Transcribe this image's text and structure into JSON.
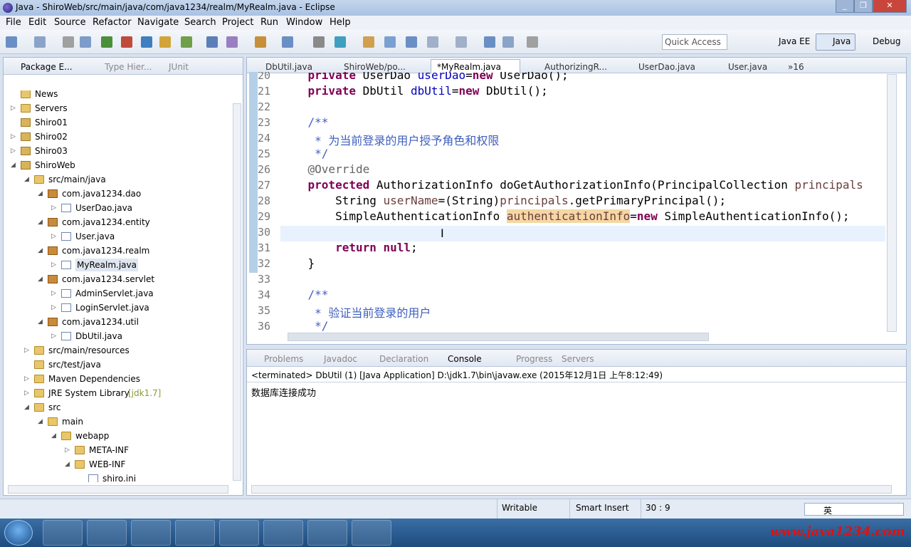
{
  "window": {
    "title": "Java - ShiroWeb/src/main/java/com/java1234/realm/MyRealm.java - Eclipse"
  },
  "menu": [
    "File",
    "Edit",
    "Source",
    "Refactor",
    "Navigate",
    "Search",
    "Project",
    "Run",
    "Window",
    "Help"
  ],
  "quick_access": {
    "placeholder": "Quick Access"
  },
  "perspectives": [
    "Java EE",
    "Java",
    "Debug"
  ],
  "left_tabs": [
    "Package E...",
    "Type Hier...",
    "JUnit"
  ],
  "tree": [
    {
      "label": "News",
      "indent": 0,
      "icon": "folder",
      "arrow": ""
    },
    {
      "label": "Servers",
      "indent": 0,
      "icon": "folder",
      "arrow": "▷"
    },
    {
      "label": "Shiro01",
      "indent": 0,
      "icon": "project",
      "arrow": ""
    },
    {
      "label": "Shiro02",
      "indent": 0,
      "icon": "project",
      "arrow": "▷"
    },
    {
      "label": "Shiro03",
      "indent": 0,
      "icon": "project",
      "arrow": "▷"
    },
    {
      "label": "ShiroWeb",
      "indent": 0,
      "icon": "project",
      "arrow": "◢"
    },
    {
      "label": "src/main/java",
      "indent": 1,
      "icon": "folder",
      "arrow": "◢"
    },
    {
      "label": "com.java1234.dao",
      "indent": 2,
      "icon": "package",
      "arrow": "◢"
    },
    {
      "label": "UserDao.java",
      "indent": 3,
      "icon": "java",
      "arrow": "▷"
    },
    {
      "label": "com.java1234.entity",
      "indent": 2,
      "icon": "package",
      "arrow": "◢"
    },
    {
      "label": "User.java",
      "indent": 3,
      "icon": "java",
      "arrow": "▷"
    },
    {
      "label": "com.java1234.realm",
      "indent": 2,
      "icon": "package",
      "arrow": "◢"
    },
    {
      "label": "MyRealm.java",
      "indent": 3,
      "icon": "java",
      "arrow": "▷"
    },
    {
      "label": "com.java1234.servlet",
      "indent": 2,
      "icon": "package",
      "arrow": "◢"
    },
    {
      "label": "AdminServlet.java",
      "indent": 3,
      "icon": "java",
      "arrow": "▷"
    },
    {
      "label": "LoginServlet.java",
      "indent": 3,
      "icon": "java",
      "arrow": "▷"
    },
    {
      "label": "com.java1234.util",
      "indent": 2,
      "icon": "package",
      "arrow": "◢"
    },
    {
      "label": "DbUtil.java",
      "indent": 3,
      "icon": "java",
      "arrow": "▷"
    },
    {
      "label": "src/main/resources",
      "indent": 1,
      "icon": "folder",
      "arrow": "▷"
    },
    {
      "label": "src/test/java",
      "indent": 1,
      "icon": "folder",
      "arrow": ""
    },
    {
      "label": "Maven Dependencies",
      "indent": 1,
      "icon": "folder",
      "arrow": "▷"
    },
    {
      "label": "JRE System Library",
      "extra": "[jdk1.7]",
      "indent": 1,
      "icon": "folder",
      "arrow": "▷"
    },
    {
      "label": "src",
      "indent": 1,
      "icon": "folder",
      "arrow": "◢"
    },
    {
      "label": "main",
      "indent": 2,
      "icon": "folder",
      "arrow": "◢"
    },
    {
      "label": "webapp",
      "indent": 3,
      "icon": "folder",
      "arrow": "◢"
    },
    {
      "label": "META-INF",
      "indent": 4,
      "icon": "folder",
      "arrow": "▷"
    },
    {
      "label": "WEB-INF",
      "indent": 4,
      "icon": "folder",
      "arrow": "◢"
    },
    {
      "label": "shiro.ini",
      "indent": 5,
      "icon": "file",
      "arrow": ""
    }
  ],
  "editor_tabs": [
    "DbUtil.java",
    "ShiroWeb/po...",
    "*MyRealm.java",
    "AuthorizingR...",
    "UserDao.java",
    "User.java"
  ],
  "editor_tabs_more": "»16",
  "lines": [
    {
      "n": "20",
      "seg": [
        [
          "",
          "    "
        ],
        [
          "kw",
          "private"
        ],
        [
          "",
          " UserDao "
        ],
        [
          "fld",
          "userDao"
        ],
        [
          "",
          "="
        ],
        [
          "kw",
          "new"
        ],
        [
          "",
          " UserDao();"
        ]
      ]
    },
    {
      "n": "21",
      "seg": [
        [
          "",
          "    "
        ],
        [
          "kw",
          "private"
        ],
        [
          "",
          " DbUtil "
        ],
        [
          "fld",
          "dbUtil"
        ],
        [
          "",
          "="
        ],
        [
          "kw",
          "new"
        ],
        [
          "",
          " DbUtil();"
        ]
      ]
    },
    {
      "n": "22",
      "seg": []
    },
    {
      "n": "23",
      "seg": [
        [
          "cm",
          "    /**"
        ]
      ]
    },
    {
      "n": "24",
      "seg": [
        [
          "cm",
          "     * 为当前登录的用户授予角色和权限"
        ]
      ]
    },
    {
      "n": "25",
      "seg": [
        [
          "cm",
          "     */"
        ]
      ]
    },
    {
      "n": "26",
      "seg": [
        [
          "an",
          "    @Override"
        ]
      ]
    },
    {
      "n": "27",
      "seg": [
        [
          "",
          "    "
        ],
        [
          "kw",
          "protected"
        ],
        [
          "",
          " AuthorizationInfo doGetAuthorizationInfo(PrincipalCollection "
        ],
        [
          "var",
          "principals"
        ]
      ]
    },
    {
      "n": "28",
      "seg": [
        [
          "",
          "        String "
        ],
        [
          "var",
          "userName"
        ],
        [
          "",
          "=(String)"
        ],
        [
          "var",
          "principals"
        ],
        [
          "",
          ".getPrimaryPrincipal();"
        ]
      ]
    },
    {
      "n": "29",
      "seg": [
        [
          "",
          "        SimpleAuthenticationInfo "
        ],
        [
          "hl",
          "authenticationInfo"
        ],
        [
          "",
          "="
        ],
        [
          "kw",
          "new"
        ],
        [
          "",
          " SimpleAuthenticationInfo();"
        ]
      ]
    },
    {
      "n": "30",
      "seg": []
    },
    {
      "n": "31",
      "seg": [
        [
          "",
          "        "
        ],
        [
          "kw",
          "return"
        ],
        [
          "",
          " "
        ],
        [
          "kw",
          "null"
        ],
        [
          "",
          ";"
        ]
      ]
    },
    {
      "n": "32",
      "seg": [
        [
          "",
          "    }"
        ]
      ]
    },
    {
      "n": "33",
      "seg": []
    },
    {
      "n": "34",
      "seg": [
        [
          "cm",
          "    /**"
        ]
      ]
    },
    {
      "n": "35",
      "seg": [
        [
          "cm",
          "     * 验证当前登录的用户"
        ]
      ]
    },
    {
      "n": "36",
      "seg": [
        [
          "cm",
          "     */"
        ]
      ]
    }
  ],
  "bottom_tabs": [
    "Problems",
    "Javadoc",
    "Declaration",
    "Console",
    "Progress",
    "Servers"
  ],
  "console": {
    "header": "<terminated> DbUtil (1) [Java Application] D:\\jdk1.7\\bin\\javaw.exe (2015年12月1日 上午8:12:49)",
    "output": "数据库连接成功"
  },
  "status": {
    "mode": "Writable",
    "insert": "Smart Insert",
    "pos": "30 : 9"
  },
  "ime": "英",
  "watermark": "www.java1234.com"
}
